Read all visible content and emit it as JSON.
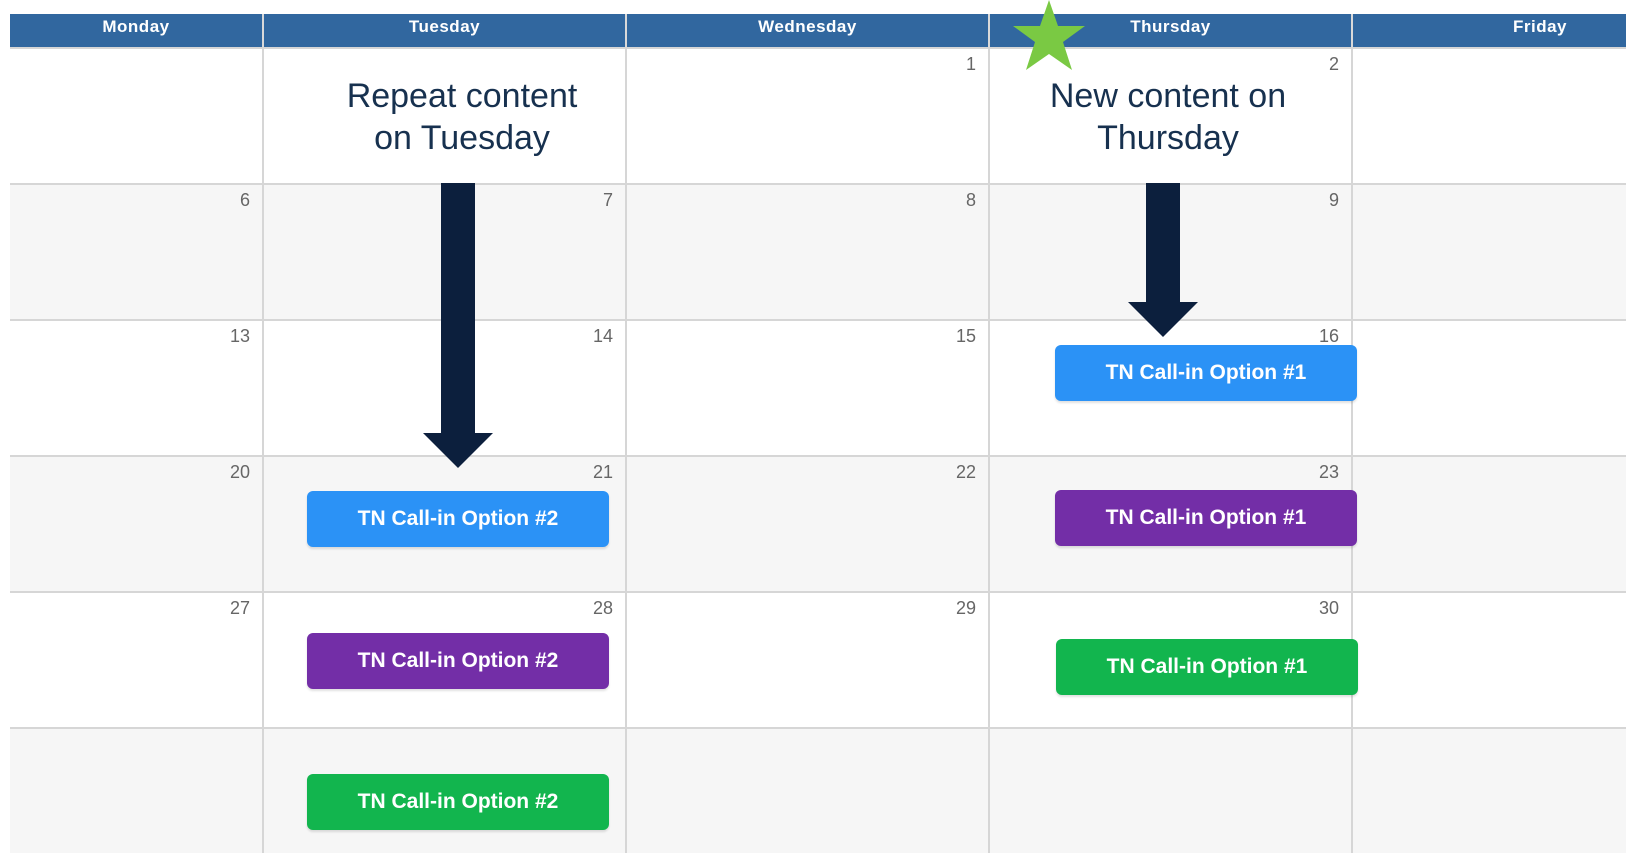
{
  "calendar": {
    "days": [
      {
        "label": "Monday"
      },
      {
        "label": "Tuesday"
      },
      {
        "label": "Wednesday"
      },
      {
        "label": "Thursday"
      },
      {
        "label": "Friday"
      }
    ],
    "weeks": [
      {
        "cells": [
          "",
          "",
          "1",
          "2",
          ""
        ]
      },
      {
        "cells": [
          "6",
          "7",
          "8",
          "9",
          ""
        ]
      },
      {
        "cells": [
          "13",
          "14",
          "15",
          "16",
          ""
        ]
      },
      {
        "cells": [
          "20",
          "21",
          "22",
          "23",
          ""
        ]
      },
      {
        "cells": [
          "27",
          "28",
          "29",
          "30",
          ""
        ]
      },
      {
        "cells": [
          "",
          "",
          "",
          "",
          ""
        ]
      }
    ]
  },
  "annotations": {
    "tuesday": {
      "line1": "Repeat content",
      "line2": "on Tuesday"
    },
    "thursday": {
      "line1": "New content on",
      "line2": "Thursday"
    }
  },
  "events": {
    "tuesday": [
      {
        "label": "TN Call-in Option #2",
        "color": "#2b92f6"
      },
      {
        "label": "TN Call-in Option #2",
        "color": "#732ea7"
      },
      {
        "label": "TN Call-in Option #2",
        "color": "#12b54e"
      }
    ],
    "thursday": [
      {
        "label": "TN Call-in Option #1",
        "color": "#2b92f6"
      },
      {
        "label": "TN Call-in Option #1",
        "color": "#732ea7"
      },
      {
        "label": "TN Call-in Option #1",
        "color": "#12b54e"
      }
    ]
  },
  "colors": {
    "header": "#31679f",
    "arrow": "#0c1f3d",
    "star": "#7ac943",
    "annotation_text": "#17314f",
    "grid": "#d6d6d6"
  },
  "icons": {
    "arrow": "down-arrow-icon",
    "star": "star-icon"
  }
}
